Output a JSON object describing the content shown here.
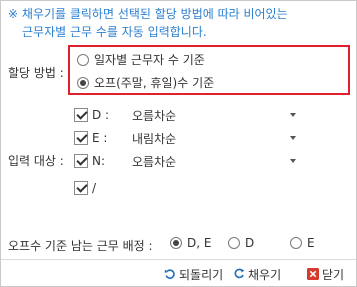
{
  "notice": {
    "line1": "※ 채우기를 클릭하면 선택된 할당 방법에 따라 비어있는",
    "line2": "근무자별 근무 수를 자동 입력합니다."
  },
  "allocation": {
    "label": "할당 방법 :",
    "options": [
      {
        "label": "일자별 근무자 수 기준",
        "selected": false
      },
      {
        "label": "오프(주말, 휴일)수 기준",
        "selected": true
      }
    ],
    "highlight_color": "#e0202a"
  },
  "input_target": {
    "label": "입력 대상 :",
    "rows": [
      {
        "code": "D :",
        "checked": true,
        "order": "오름차순",
        "has_select": true
      },
      {
        "code": "E :",
        "checked": true,
        "order": "내림차순",
        "has_select": true
      },
      {
        "code": "N:",
        "checked": true,
        "order": "오름차순",
        "has_select": true
      },
      {
        "code": "/",
        "checked": true,
        "order": "",
        "has_select": false
      }
    ]
  },
  "remaining": {
    "label": "오프수 기준 남는 근무 배정 :",
    "options": [
      {
        "label": "D, E",
        "selected": true
      },
      {
        "label": "D",
        "selected": false
      },
      {
        "label": "E",
        "selected": false
      }
    ]
  },
  "footer": {
    "reset_label": "되돌리기",
    "fill_label": "채우기",
    "close_label": "닫기"
  },
  "colors": {
    "notice_text": "#2b7fd0",
    "reset_icon": "#1f6fb8",
    "fill_icon": "#1f6fb8",
    "close_icon": "#d63a2a"
  }
}
